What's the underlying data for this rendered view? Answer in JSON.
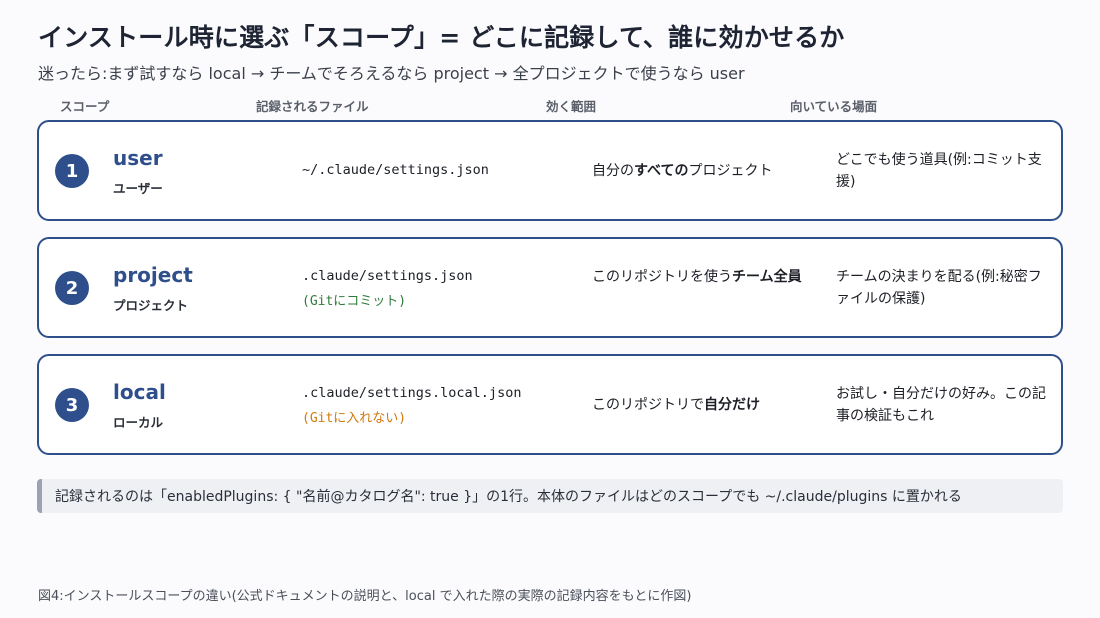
{
  "title": "インストール時に選ぶ「スコープ」= どこに記録して、誰に効かせるか",
  "subtitle": "迷ったら:まず試すなら local → チームでそろえるなら project → 全プロジェクトで使うなら user",
  "headers": {
    "scope": "スコープ",
    "file": "記録されるファイル",
    "range": "効く範囲",
    "usecase": "向いている場面"
  },
  "rows": [
    {
      "number": "1",
      "name": "user",
      "name_jp": "ユーザー",
      "file": "~/.claude/settings.json",
      "note": "",
      "range_pre": "自分の",
      "range_bold": "すべての",
      "range_post": "プロジェクト",
      "usecase": "どこでも使う道具(例:コミット支援)"
    },
    {
      "number": "2",
      "name": "project",
      "name_jp": "プロジェクト",
      "file": ".claude/settings.json",
      "note": "(Gitにコミット)",
      "range_pre": "このリポジトリを使う",
      "range_bold": "チーム全員",
      "range_post": "",
      "usecase": "チームの決まりを配る(例:秘密ファイルの保護)"
    },
    {
      "number": "3",
      "name": "local",
      "name_jp": "ローカル",
      "file": ".claude/settings.local.json",
      "note": "(Gitに入れない)",
      "range_pre": "このリポジトリで",
      "range_bold": "自分だけ",
      "range_post": "",
      "usecase": "お試し・自分だけの好み。この記事の検証もこれ"
    }
  ],
  "callout": "記録されるのは「enabledPlugins: { \"名前@カタログ名\": true }」の1行。本体のファイルはどのスコープでも ~/.claude/plugins に置かれる",
  "caption": "図4:インストールスコープの違い(公式ドキュメントの説明と、local で入れた際の実際の記録内容をもとに作図)"
}
